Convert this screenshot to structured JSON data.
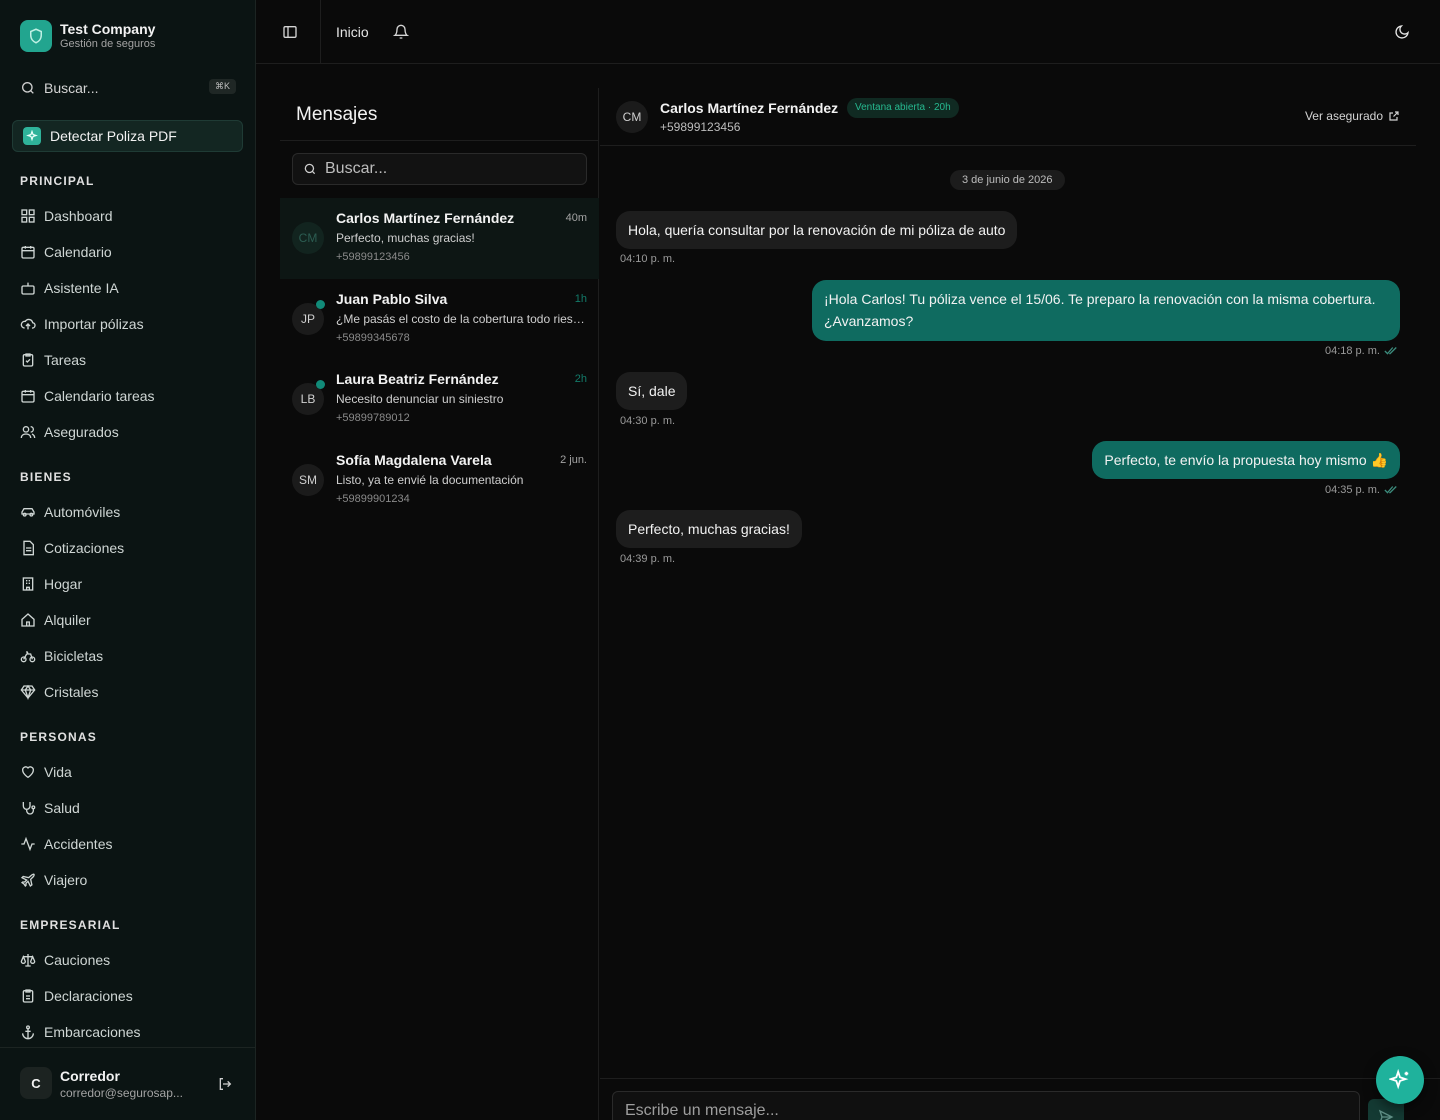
{
  "brand": {
    "name": "Test Company",
    "subtitle": "Gestión de seguros"
  },
  "sidebar": {
    "search_label": "Buscar...",
    "search_shortcut": "⌘K",
    "detect_button": "Detectar Poliza PDF",
    "sections": {
      "principal": "PRINCIPAL",
      "bienes": "BIENES",
      "personas": "PERSONAS",
      "empresarial": "EMPRESARIAL"
    },
    "items": {
      "dashboard": "Dashboard",
      "calendario": "Calendario",
      "asistente": "Asistente IA",
      "importar": "Importar pólizas",
      "tareas": "Tareas",
      "calendario_tareas": "Calendario tareas",
      "asegurados": "Asegurados",
      "automoviles": "Automóviles",
      "cotizaciones": "Cotizaciones",
      "hogar": "Hogar",
      "alquiler": "Alquiler",
      "bicicletas": "Bicicletas",
      "cristales": "Cristales",
      "vida": "Vida",
      "salud": "Salud",
      "accidentes": "Accidentes",
      "viajero": "Viajero",
      "cauciones": "Cauciones",
      "declaraciones": "Declaraciones",
      "embarcaciones": "Embarcaciones"
    },
    "user": {
      "initial": "C",
      "name": "Corredor",
      "email": "corredor@segurosap..."
    }
  },
  "header": {
    "breadcrumb": "Inicio"
  },
  "conversations": {
    "title": "Mensajes",
    "search_placeholder": "Buscar...",
    "items": [
      {
        "initials": "CM",
        "name": "Carlos Martínez Fernández",
        "time": "40m",
        "preview": "Perfecto, muchas gracias!",
        "phone": "+59899123456",
        "unread": false
      },
      {
        "initials": "JP",
        "name": "Juan Pablo Silva",
        "time": "1h",
        "preview": "¿Me pasás el costo de la cobertura todo riesgo?",
        "phone": "+59899345678",
        "unread": true
      },
      {
        "initials": "LB",
        "name": "Laura Beatriz Fernández",
        "time": "2h",
        "preview": "Necesito denunciar un siniestro",
        "phone": "+59899789012",
        "unread": true
      },
      {
        "initials": "SM",
        "name": "Sofía Magdalena Varela",
        "time": "2 jun.",
        "preview": "Listo, ya te envié la documentación",
        "phone": "+59899901234",
        "unread": false
      }
    ]
  },
  "chat": {
    "initials": "CM",
    "name": "Carlos Martínez Fernández",
    "badge": "Ventana abierta · 20h",
    "phone": "+59899123456",
    "view_link": "Ver asegurado",
    "date": "3 de junio de 2026",
    "messages": [
      {
        "dir": "in",
        "text": "Hola, quería consultar por la renovación de mi póliza de auto",
        "time": "04:10 p. m."
      },
      {
        "dir": "out",
        "line1": "¡Hola Carlos! Tu póliza vence el 15/06. Te preparo la renovación con la misma cobertura.",
        "line2": "¿Avanzamos?",
        "time": "04:18 p. m."
      },
      {
        "dir": "in",
        "text": "Sí, dale",
        "time": "04:30 p. m."
      },
      {
        "dir": "out",
        "text": "Perfecto, te envío la propuesta hoy mismo 👍",
        "time": "04:35 p. m."
      },
      {
        "dir": "in",
        "text": "Perfecto, muchas gracias!",
        "time": "04:39 p. m."
      }
    ],
    "composer_placeholder": "Escribe un mensaje..."
  },
  "colors": {
    "accent": "#0f6b60",
    "brand": "#22a58f",
    "badge_text": "#26b88f"
  }
}
